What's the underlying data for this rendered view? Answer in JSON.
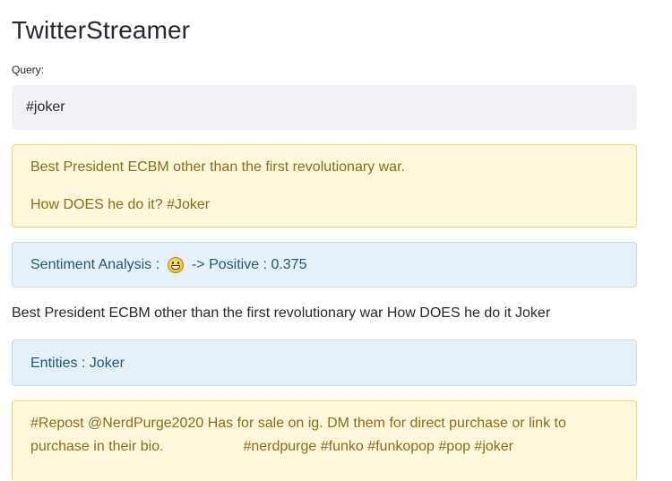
{
  "app": {
    "title": "TwitterStreamer"
  },
  "query": {
    "label": "Query:",
    "value": "#joker"
  },
  "tweets": [
    {
      "line_1": "Best President ECBM other than the first revolutionary war.",
      "line_2": "How DOES he do it? #Joker"
    },
    {
      "line_1": "#Repost @NerdPurge2020 Has for sale on ig. DM them for direct purchase or link to",
      "line_2": "purchase in their bio.                    #nerdpurge #funko #funkopop #pop #joker"
    }
  ],
  "sentiment": {
    "prefix": "Sentiment Analysis : ",
    "emoji_icon": "grimacing-face-emoji",
    "suffix": " -> Positive : 0.375"
  },
  "cleaned_text": "Best President ECBM other than the first revolutionary war How DOES he do it Joker",
  "entities": {
    "text": "Entities : Joker"
  },
  "colors": {
    "warning_bg": "#fff8dc",
    "warning_text": "#8a6d1a",
    "info_bg": "#e6f0f8",
    "info_text": "#1f5a74",
    "input_bg": "#f0f2f6"
  }
}
